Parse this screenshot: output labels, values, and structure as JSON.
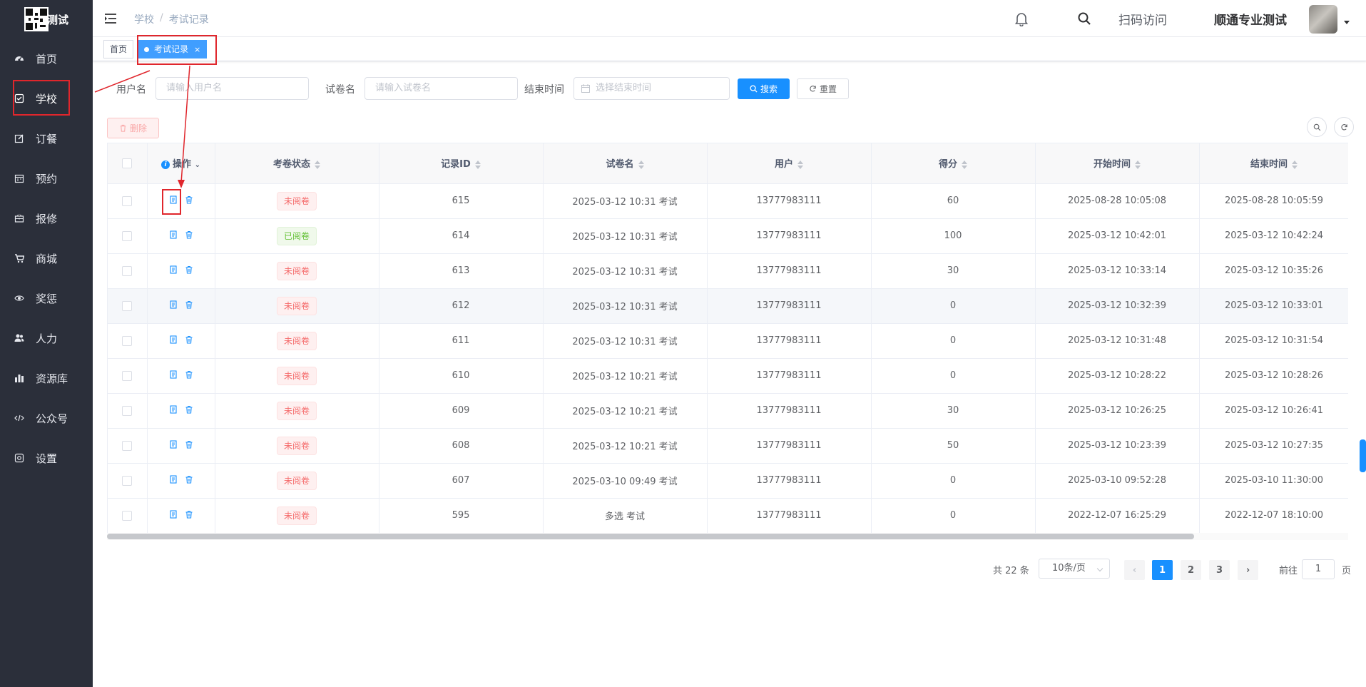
{
  "app": {
    "logo_text": "测试"
  },
  "sidebar": {
    "items": [
      {
        "label": "首页",
        "icon": "dashboard-icon"
      },
      {
        "label": "学校",
        "icon": "checkbox-icon",
        "active": true
      },
      {
        "label": "订餐",
        "icon": "edit-icon"
      },
      {
        "label": "预约",
        "icon": "calendar-icon"
      },
      {
        "label": "报修",
        "icon": "toolbox-icon"
      },
      {
        "label": "商城",
        "icon": "cart-icon"
      },
      {
        "label": "奖惩",
        "icon": "eye-icon"
      },
      {
        "label": "人力",
        "icon": "people-icon"
      },
      {
        "label": "资源库",
        "icon": "chart-icon"
      },
      {
        "label": "公众号",
        "icon": "code-icon"
      },
      {
        "label": "设置",
        "icon": "settings-icon"
      }
    ]
  },
  "navbar": {
    "breadcrumb": [
      "学校",
      "考试记录"
    ],
    "scan_label": "扫码访问",
    "user_name": "顺通专业测试"
  },
  "tags": [
    {
      "label": "首页"
    },
    {
      "label": "考试记录",
      "close": "×",
      "active": true
    }
  ],
  "filters": {
    "username_label": "用户名",
    "username_placeholder": "请输入用户名",
    "paper_label": "试卷名",
    "paper_placeholder": "请输入试卷名",
    "end_label": "结束时间",
    "end_placeholder": "选择结束时间",
    "search_btn": "搜索",
    "reset_btn": "重置"
  },
  "toolbar": {
    "delete_btn": "删除"
  },
  "table": {
    "columns": [
      "操作",
      "考卷状态",
      "记录ID",
      "试卷名",
      "用户",
      "得分",
      "开始时间",
      "结束时间"
    ],
    "rows": [
      {
        "status": "未阅卷",
        "read": false,
        "id": "615",
        "paper": "2025-03-12 10:31 考试",
        "user": "13777983111",
        "score": "60",
        "start": "2025-08-28 10:05:08",
        "end": "2025-08-28 10:05:59"
      },
      {
        "status": "已阅卷",
        "read": true,
        "id": "614",
        "paper": "2025-03-12 10:31 考试",
        "user": "13777983111",
        "score": "100",
        "start": "2025-03-12 10:42:01",
        "end": "2025-03-12 10:42:24"
      },
      {
        "status": "未阅卷",
        "read": false,
        "id": "613",
        "paper": "2025-03-12 10:31 考试",
        "user": "13777983111",
        "score": "30",
        "start": "2025-03-12 10:33:14",
        "end": "2025-03-12 10:35:26"
      },
      {
        "status": "未阅卷",
        "read": false,
        "id": "612",
        "paper": "2025-03-12 10:31 考试",
        "user": "13777983111",
        "score": "0",
        "start": "2025-03-12 10:32:39",
        "end": "2025-03-12 10:33:01"
      },
      {
        "status": "未阅卷",
        "read": false,
        "id": "611",
        "paper": "2025-03-12 10:31 考试",
        "user": "13777983111",
        "score": "0",
        "start": "2025-03-12 10:31:48",
        "end": "2025-03-12 10:31:54"
      },
      {
        "status": "未阅卷",
        "read": false,
        "id": "610",
        "paper": "2025-03-12 10:21 考试",
        "user": "13777983111",
        "score": "0",
        "start": "2025-03-12 10:28:22",
        "end": "2025-03-12 10:28:26"
      },
      {
        "status": "未阅卷",
        "read": false,
        "id": "609",
        "paper": "2025-03-12 10:21 考试",
        "user": "13777983111",
        "score": "30",
        "start": "2025-03-12 10:26:25",
        "end": "2025-03-12 10:26:41"
      },
      {
        "status": "未阅卷",
        "read": false,
        "id": "608",
        "paper": "2025-03-12 10:21 考试",
        "user": "13777983111",
        "score": "50",
        "start": "2025-03-12 10:23:39",
        "end": "2025-03-12 10:27:35"
      },
      {
        "status": "未阅卷",
        "read": false,
        "id": "607",
        "paper": "2025-03-10 09:49 考试",
        "user": "13777983111",
        "score": "0",
        "start": "2025-03-10 09:52:28",
        "end": "2025-03-10 11:30:00"
      },
      {
        "status": "未阅卷",
        "read": false,
        "id": "595",
        "paper": "多选 考试",
        "user": "13777983111",
        "score": "0",
        "start": "2022-12-07 16:25:29",
        "end": "2022-12-07 18:10:00"
      }
    ]
  },
  "pagination": {
    "total": "共 22 条",
    "page_size": "10条/页",
    "pages": [
      "1",
      "2",
      "3"
    ],
    "current": "1",
    "goto_prefix": "前往",
    "goto_value": "1",
    "goto_suffix": "页"
  },
  "colors": {
    "sidebar_bg": "#2b2f3a",
    "primary": "#1890ff",
    "highlight": "#e0262c",
    "unread": "#f56c6c",
    "read": "#67c23a"
  }
}
